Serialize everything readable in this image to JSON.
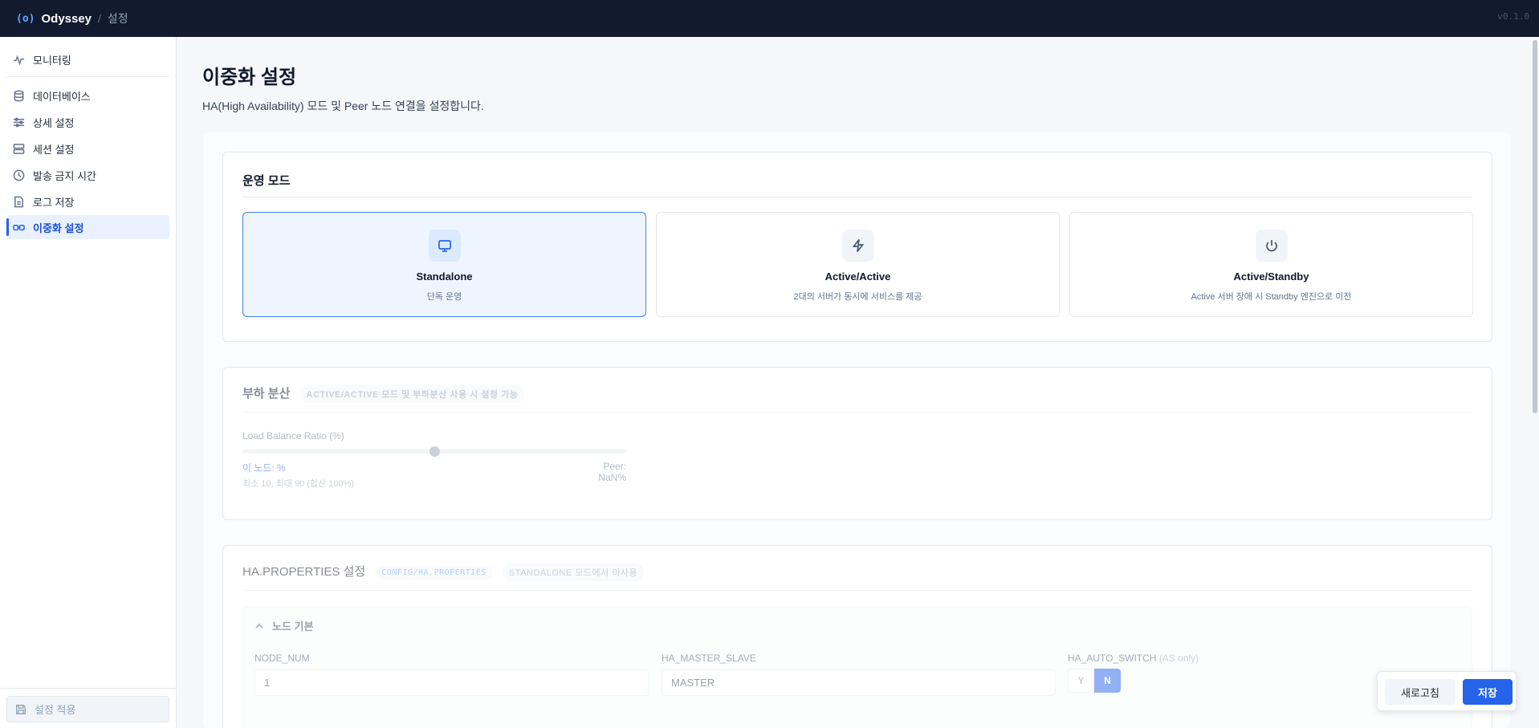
{
  "topbar": {
    "logo": "(o)",
    "app_name": "Odyssey",
    "separator": "/",
    "page": "설정",
    "version": "v0.1.0"
  },
  "sidebar": {
    "items": [
      {
        "label": "모니터링",
        "icon": "activity-icon",
        "active": false
      },
      {
        "label": "데이터베이스",
        "icon": "database-icon",
        "active": false
      },
      {
        "label": "상세 설정",
        "icon": "sliders-icon",
        "active": false
      },
      {
        "label": "세션 설정",
        "icon": "server-icon",
        "active": false
      },
      {
        "label": "발송 금지 시간",
        "icon": "clock-icon",
        "active": false
      },
      {
        "label": "로그 저장",
        "icon": "file-icon",
        "active": false
      },
      {
        "label": "이중화 설정",
        "icon": "link-icon",
        "active": true
      }
    ],
    "apply_label": "설정 적용"
  },
  "page": {
    "title": "이중화 설정",
    "description": "HA(High Availability) 모드 및 Peer 노드 연결을 설정합니다."
  },
  "operation_mode": {
    "title": "운영 모드",
    "options": [
      {
        "name": "Standalone",
        "desc": "단독 운영",
        "icon": "monitor-icon",
        "selected": true
      },
      {
        "name": "Active/Active",
        "desc": "2대의 서버가 동시에 서비스를 제공",
        "icon": "lightning-icon",
        "selected": false
      },
      {
        "name": "Active/Standby",
        "desc": "Active 서버 장애 시 Standby 엔진으로 이전",
        "icon": "power-icon",
        "selected": false
      }
    ]
  },
  "load_balance": {
    "title": "부하 분산",
    "tag": "ACTIVE/ACTIVE 모드 및 부하분산 사용 시 설정 가능",
    "slider_label": "Load Balance Ratio (%)",
    "slider_fraction": 0.5,
    "this_node": "이 노드: %",
    "peer": "Peer: NaN%",
    "hint": "최소 10, 최대 90 (합산 100%)"
  },
  "ha_properties": {
    "title": "HA.PROPERTIES 설정",
    "tag_path": "CONFIG/HA.PROPERTIES",
    "tag_status": "STANDALONE 모드에서 미사용",
    "section_title": "노드 기본",
    "fields": {
      "node_num_label": "NODE_NUM",
      "node_num_value": "1",
      "master_slave_label": "HA_MASTER_SLAVE",
      "master_slave_value": "MASTER",
      "auto_switch_label": "HA_AUTO_SWITCH",
      "auto_switch_note": "(AS only)",
      "auto_switch_yes": "Y",
      "auto_switch_no": "N",
      "auto_switch_value": "N"
    }
  },
  "actions": {
    "refresh_label": "새로고침",
    "save_label": "저장"
  },
  "colors": {
    "accent": "#2563eb",
    "topbar": "#111a2e",
    "selected_bg": "#eff5fe"
  }
}
